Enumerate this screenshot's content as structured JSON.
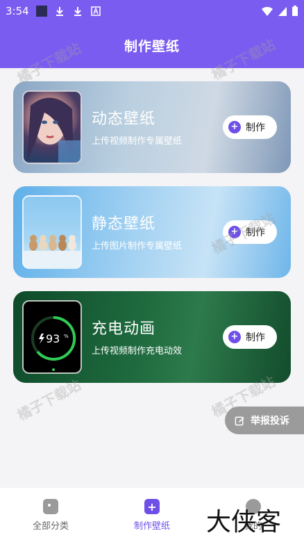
{
  "status": {
    "time": "3:54"
  },
  "appbar": {
    "title": "制作壁纸"
  },
  "cards": [
    {
      "title": "动态壁纸",
      "subtitle": "上传视频制作专属壁纸",
      "button": "制作"
    },
    {
      "title": "静态壁纸",
      "subtitle": "上传图片制作专属壁纸",
      "button": "制作"
    },
    {
      "title": "充电动画",
      "subtitle": "上传视频制作充电动效",
      "button": "制作",
      "battery": "93",
      "battery_unit": "%"
    }
  ],
  "report": {
    "label": "举报投诉"
  },
  "tabs": [
    {
      "label": "全部分类"
    },
    {
      "label": "制作壁纸"
    },
    {
      "label": "我的"
    }
  ],
  "watermark": "橘子下载站",
  "brand_overlay": "大侠客",
  "colors": {
    "primary": "#7b5cf0",
    "accent": "#6e50e8"
  }
}
